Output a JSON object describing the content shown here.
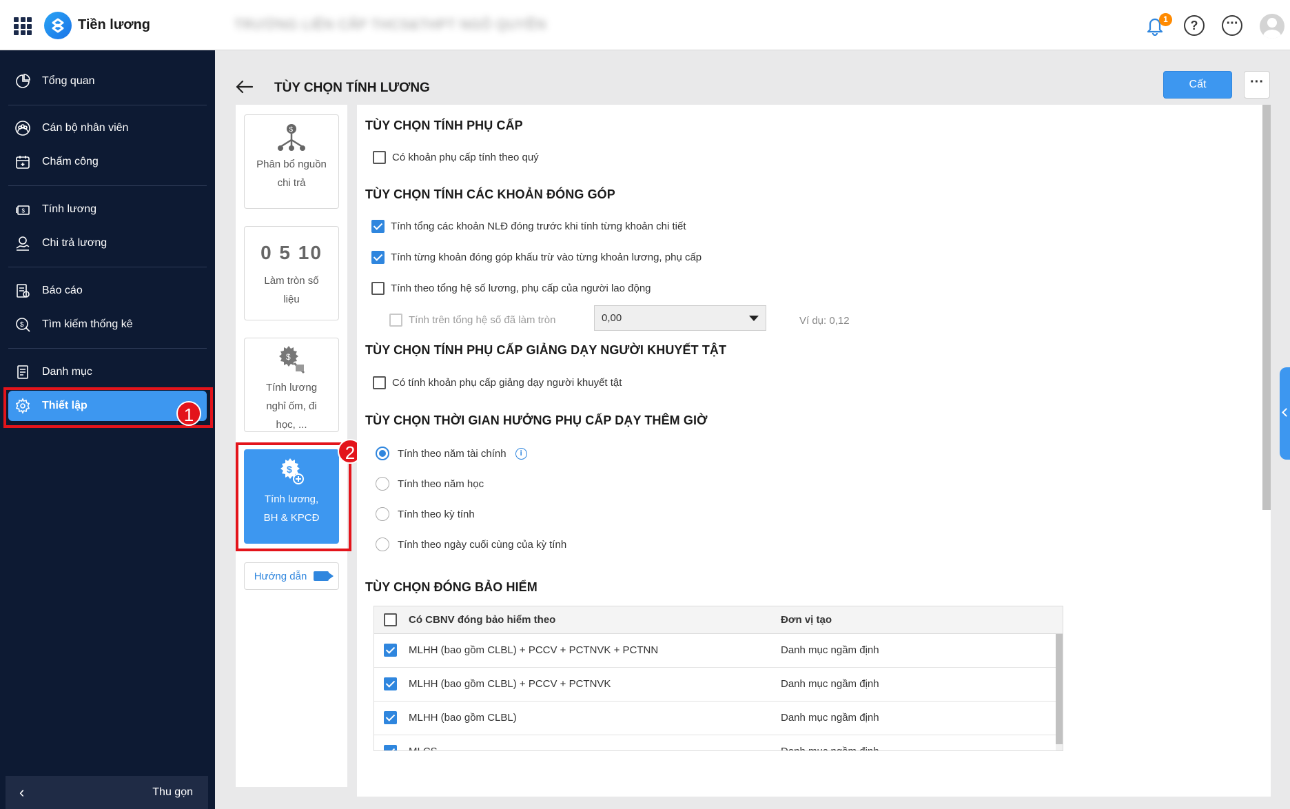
{
  "topbar": {
    "app_title": "Tiền lương",
    "org_name": "TRƯỜNG LIÊN CẤP THCS&THPT NGÔ QUYỀN",
    "notification_count": "1",
    "help_symbol": "?",
    "more_symbol": "···"
  },
  "sidebar": {
    "items": [
      {
        "label": "Tổng quan",
        "icon": "pie-chart-icon"
      },
      {
        "label": "Cán bộ nhân viên",
        "icon": "staff-icon"
      },
      {
        "label": "Chấm công",
        "icon": "calendar-icon"
      },
      {
        "label": "Tính lương",
        "icon": "money-icon"
      },
      {
        "label": "Chi trả lương",
        "icon": "payment-icon"
      },
      {
        "label": "Báo cáo",
        "icon": "report-icon"
      },
      {
        "label": "Tìm kiếm thống kê",
        "icon": "search-money-icon"
      },
      {
        "label": "Danh mục",
        "icon": "list-icon"
      },
      {
        "label": "Thiết lập",
        "icon": "gear-icon"
      }
    ],
    "collapse_label": "Thu gọn",
    "step1": "1"
  },
  "header": {
    "title": "TÙY CHỌN TÍNH LƯƠNG",
    "save_label": "Cất",
    "more_label": "···"
  },
  "tabs": {
    "items": [
      {
        "label": "Phân bổ nguồn chi trả"
      },
      {
        "label": "Làm tròn số liệu",
        "icon_text": "0 5 10"
      },
      {
        "label": "Tính lương nghỉ ốm, đi học, ..."
      },
      {
        "label": "Tính lương, BH & KPCĐ"
      }
    ],
    "guide_label": "Hướng dẫn",
    "step2": "2"
  },
  "sections": {
    "allowance": {
      "title": "TÙY CHỌN TÍNH PHỤ CẤP",
      "opt1": "Có khoản phụ cấp tính theo quý"
    },
    "contribution": {
      "title": "TÙY CHỌN TÍNH CÁC KHOẢN ĐÓNG GÓP",
      "opt1": "Tính tổng các khoản NLĐ đóng trước khi tính từng khoản chi tiết",
      "opt2": "Tính từng khoản đóng góp khấu trừ vào từng khoản lương, phụ cấp",
      "opt3": "Tính theo tổng hệ số lương, phụ cấp của người lao động",
      "opt4": "Tính trên tổng hệ số đã làm tròn",
      "rounding_value": "0,00",
      "example": "Ví dụ: 0,12"
    },
    "disabled_allowance": {
      "title": "TÙY CHỌN TÍNH PHỤ CẤP GIẢNG DẠY NGƯỜI KHUYẾT TẬT",
      "opt1": "Có tính khoản phụ cấp giảng dạy người khuyết tật"
    },
    "overtime": {
      "title": "TÙY CHỌN THỜI GIAN HƯỞNG PHỤ CẤP DẠY THÊM GIỜ",
      "opt1": "Tính theo năm tài chính",
      "opt2": "Tính theo năm học",
      "opt3": "Tính theo kỳ tính",
      "opt4": "Tính theo ngày cuối cùng của kỳ tính",
      "info_symbol": "i"
    },
    "insurance": {
      "title": "TÙY CHỌN ĐÓNG BẢO HIỂM",
      "col1": "Có CBNV đóng bảo hiểm theo",
      "col2": "Đơn vị tạo",
      "rows": [
        {
          "name": "MLHH (bao gồm CLBL) + PCCV + PCTNVK + PCTNN",
          "unit": "Danh mục ngầm định"
        },
        {
          "name": "MLHH (bao gồm CLBL) + PCCV + PCTNVK",
          "unit": "Danh mục ngầm định"
        },
        {
          "name": "MLHH (bao gồm CLBL)",
          "unit": "Danh mục ngầm định"
        },
        {
          "name": "MLCS",
          "unit": "Danh mục ngầm định"
        }
      ]
    }
  },
  "colors": {
    "accent": "#3d97f0",
    "sidebar_bg": "#0d1a33",
    "highlight": "#e3141b",
    "badge": "#ff8a00"
  }
}
